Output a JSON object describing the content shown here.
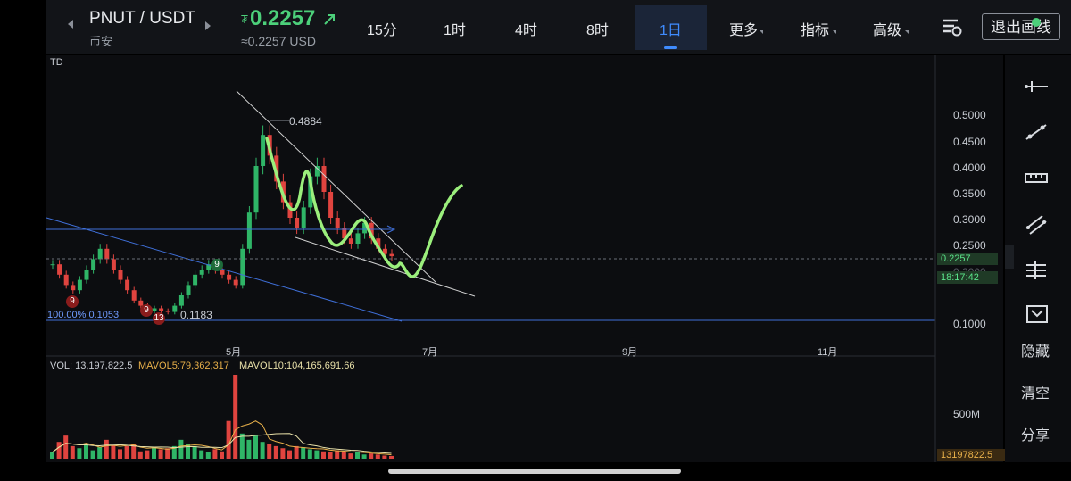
{
  "header": {
    "pair": "PNUT / USDT",
    "exchange": "币安",
    "currency_symbol": "₮",
    "price": "0.2257",
    "price_usd": "≈0.2257 USD",
    "timeframes": [
      "15分",
      "1时",
      "4时",
      "8时",
      "1日"
    ],
    "active_timeframe": "1日",
    "menus": [
      "更多",
      "指标",
      "高级"
    ],
    "exit_button": "退出画线"
  },
  "sidebar": {
    "actions": [
      "隐藏",
      "清空",
      "分享"
    ]
  },
  "chart_data": {
    "type": "candlestick",
    "indicator_label": "TD",
    "y_axis_ticks": [
      "0.5000",
      "0.4500",
      "0.4000",
      "0.3500",
      "0.3000",
      "0.2500",
      "0.2000",
      "0.1000"
    ],
    "ylim": [
      0.1,
      0.5
    ],
    "x_axis_ticks": [
      "5月",
      "7月",
      "9月",
      "11月"
    ],
    "current_price": "0.2257",
    "countdown": "18:17:42",
    "annotations": {
      "high_label": "0.4884",
      "low_label": "0.1183",
      "fib_label": "100.00% 0.1053",
      "td_counts": [
        "9",
        "9",
        "13",
        "9"
      ]
    },
    "volume": {
      "label_vol": "VOL: 13,197,822.5",
      "label_mavol5": "MAVOL5:79,362,317",
      "label_mavol10": "MAVOL10:104,165,691.66",
      "axis_tick": "500M",
      "current": "13197822.5"
    },
    "series": [
      {
        "values": [
          0.21,
          0.19,
          0.17,
          0.16,
          0.18,
          0.2,
          0.22,
          0.24,
          0.22,
          0.2,
          0.18,
          0.16,
          0.14,
          0.13,
          0.12,
          0.125,
          0.12,
          0.118,
          0.13,
          0.15,
          0.17,
          0.19,
          0.2,
          0.21,
          0.2,
          0.19,
          0.18,
          0.17,
          0.24,
          0.31,
          0.4,
          0.46,
          0.42,
          0.37,
          0.33,
          0.3,
          0.28,
          0.32,
          0.38,
          0.4,
          0.35,
          0.3,
          0.28,
          0.26,
          0.25,
          0.27,
          0.29,
          0.26,
          0.24,
          0.23,
          0.2257
        ]
      }
    ],
    "volume_values": [
      30,
      80,
      110,
      60,
      50,
      70,
      40,
      55,
      90,
      65,
      45,
      60,
      70,
      35,
      40,
      55,
      45,
      50,
      60,
      90,
      70,
      60,
      40,
      30,
      45,
      35,
      180,
      400,
      120,
      90,
      110,
      80,
      70,
      60,
      50,
      40,
      60,
      55,
      45,
      40,
      35,
      30,
      40,
      35,
      25,
      30,
      20,
      25,
      20,
      15,
      13
    ]
  }
}
